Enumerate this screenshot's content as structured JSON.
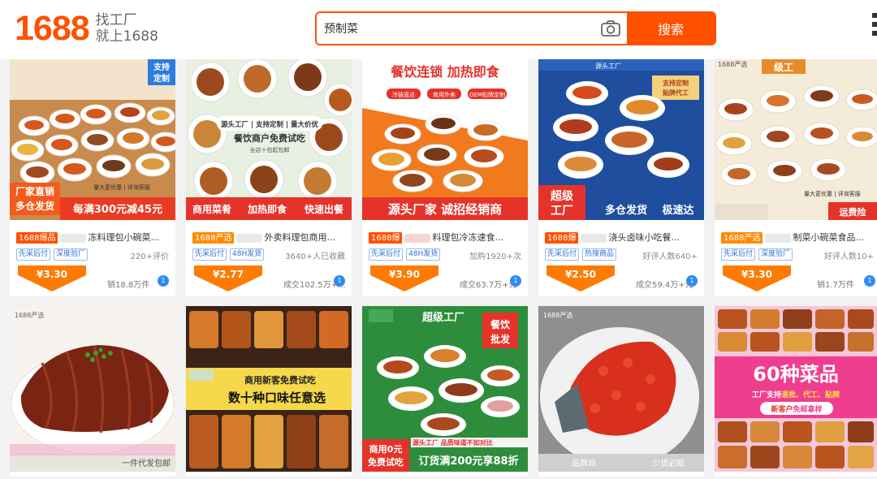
{
  "header": {
    "logo_text": "1688",
    "slogan_line1": "找工厂",
    "slogan_line2": "就上1688",
    "search_value": "预制菜",
    "search_button": "搜索",
    "camera_icon": "camera-icon"
  },
  "colors": {
    "brand": "#ff5000",
    "price": "#ff6a00",
    "tag_blue": "#2f6fd8"
  },
  "products": [
    {
      "image_caption_1": "支持",
      "image_caption_2": "定制",
      "image_banner_1": "厂家直销",
      "image_banner_2": "多仓发货",
      "image_banner_3": "每满300元减45元",
      "image_corner": "量大更优惠 | 详询客服",
      "badge": "1688爆品",
      "title_suffix": "冻料理包小碗菜...",
      "tags": [
        "先采后付",
        "深度验厂"
      ],
      "stat_a": "220+评价",
      "price": "¥3.30",
      "stat_b": "销18.8万件"
    },
    {
      "image_caption_1": "源头工厂",
      "image_caption_2": "支持定制",
      "image_caption_3": "量大价优",
      "image_sub": "餐饮商户免费试吃",
      "image_sub2": "全店十包起包邮",
      "image_banner_1": "商用菜肴",
      "image_banner_2": "加热即食",
      "image_banner_3": "快速出餐",
      "badge": "1688严选",
      "title_suffix": "外卖料理包商用...",
      "tags": [
        "先采后付",
        "48H发货"
      ],
      "stat_a": "3640+人已收藏",
      "price": "¥2.77",
      "stat_b": "成交102.5万+..."
    },
    {
      "image_caption_1": "餐饮连锁 加热即食",
      "image_caption_2": "冷链直达",
      "image_caption_3": "商用外卖",
      "image_caption_4": "OEM贴牌定制",
      "image_banner_1": "源头厂家 诚招经销商",
      "badge": "1688爆",
      "title_suffix": "料理包冷冻速食...",
      "tags": [
        "先采后付",
        "48H发货"
      ],
      "stat_a": "加购1920+次",
      "price": "¥3.90",
      "stat_b": "成交63.7万+元"
    },
    {
      "image_caption_1": "源头工厂",
      "image_caption_2": "支持定制",
      "image_caption_3": "贴牌代工",
      "image_banner_1": "超级",
      "image_banner_2": "工厂",
      "image_banner_3": "多仓发货",
      "image_banner_4": "极速达",
      "badge": "1688爆",
      "title_suffix": "浇头卤味小吃餐...",
      "tags": [
        "先采后付",
        "热搜商品"
      ],
      "stat_a": "好评人数640+",
      "price": "¥2.50",
      "stat_b": "成交59.4万+元"
    },
    {
      "image_caption_1": "1688严选",
      "image_caption_2": "级工",
      "image_corner": "量大更优惠 | 详询客服",
      "image_banner_1": "运费险",
      "badge": "1688严选",
      "title_suffix": "制菜小碗菜食品...",
      "tags": [
        "先采后付",
        "深度验厂"
      ],
      "stat_a": "好评人数10+",
      "price": "¥3.30",
      "stat_b": "销1.7万件"
    },
    {
      "image_caption_1": "1688严选",
      "image_banner_1": "一件代发包邮"
    },
    {
      "image_caption_1": "商用新客免费试吃",
      "image_caption_2": "数十种口味任意选"
    },
    {
      "image_caption_1": "超级工厂",
      "image_caption_2": "餐饮",
      "image_caption_3": "批发",
      "image_banner_1": "源头工厂",
      "image_banner_2": "品质味道不如对比",
      "image_banner_3": "商用0元",
      "image_banner_4": "免费试吃",
      "image_banner_5": "订货满200元享88折"
    },
    {
      "image_caption_1": "1688严选",
      "image_banner_1": "品牌商",
      "image_banner_2": "少货必赔"
    },
    {
      "image_caption_1": "60种菜品",
      "image_caption_2": "工厂支持",
      "image_caption_3": "退批、代工、贴牌",
      "image_caption_4": "新客户",
      "image_caption_5": "免邮拿样"
    }
  ]
}
